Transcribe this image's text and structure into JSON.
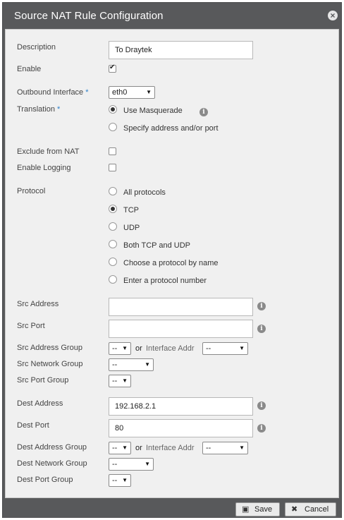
{
  "dialog": {
    "title": "Source NAT Rule Configuration",
    "close_icon": "×"
  },
  "form": {
    "description": {
      "label": "Description",
      "value": "To Draytek"
    },
    "enable": {
      "label": "Enable",
      "checked": true
    },
    "outbound_interface": {
      "label": "Outbound Interface",
      "required": "*",
      "value": "eth0"
    },
    "translation": {
      "label": "Translation",
      "required": "*",
      "options": [
        "Use Masquerade",
        "Specify address and/or port"
      ],
      "selected": "Use Masquerade"
    },
    "exclude_from_nat": {
      "label": "Exclude from NAT",
      "checked": false
    },
    "enable_logging": {
      "label": "Enable Logging",
      "checked": false
    },
    "protocol": {
      "label": "Protocol",
      "options": [
        "All protocols",
        "TCP",
        "UDP",
        "Both TCP and UDP",
        "Choose a protocol by name",
        "Enter a protocol number"
      ],
      "selected": "TCP"
    },
    "src_address": {
      "label": "Src Address",
      "value": ""
    },
    "src_port": {
      "label": "Src Port",
      "value": ""
    },
    "src_address_group": {
      "label": "Src Address Group",
      "value": "--",
      "or": "or",
      "interface_label": "Interface Addr",
      "interface_value": "--"
    },
    "src_network_group": {
      "label": "Src Network Group",
      "value": "--"
    },
    "src_port_group": {
      "label": "Src Port Group",
      "value": "--"
    },
    "dest_address": {
      "label": "Dest Address",
      "value": "192.168.2.1"
    },
    "dest_port": {
      "label": "Dest Port",
      "value": "80"
    },
    "dest_address_group": {
      "label": "Dest Address Group",
      "value": "--",
      "or": "or",
      "interface_label": "Interface Addr",
      "interface_value": "--"
    },
    "dest_network_group": {
      "label": "Dest Network Group",
      "value": "--"
    },
    "dest_port_group": {
      "label": "Dest Port Group",
      "value": "--"
    }
  },
  "footer": {
    "save_label": "Save",
    "cancel_label": "Cancel"
  },
  "icons": {
    "info": "i",
    "dropdown": "▼",
    "save": "💾",
    "cancel": "✖"
  }
}
